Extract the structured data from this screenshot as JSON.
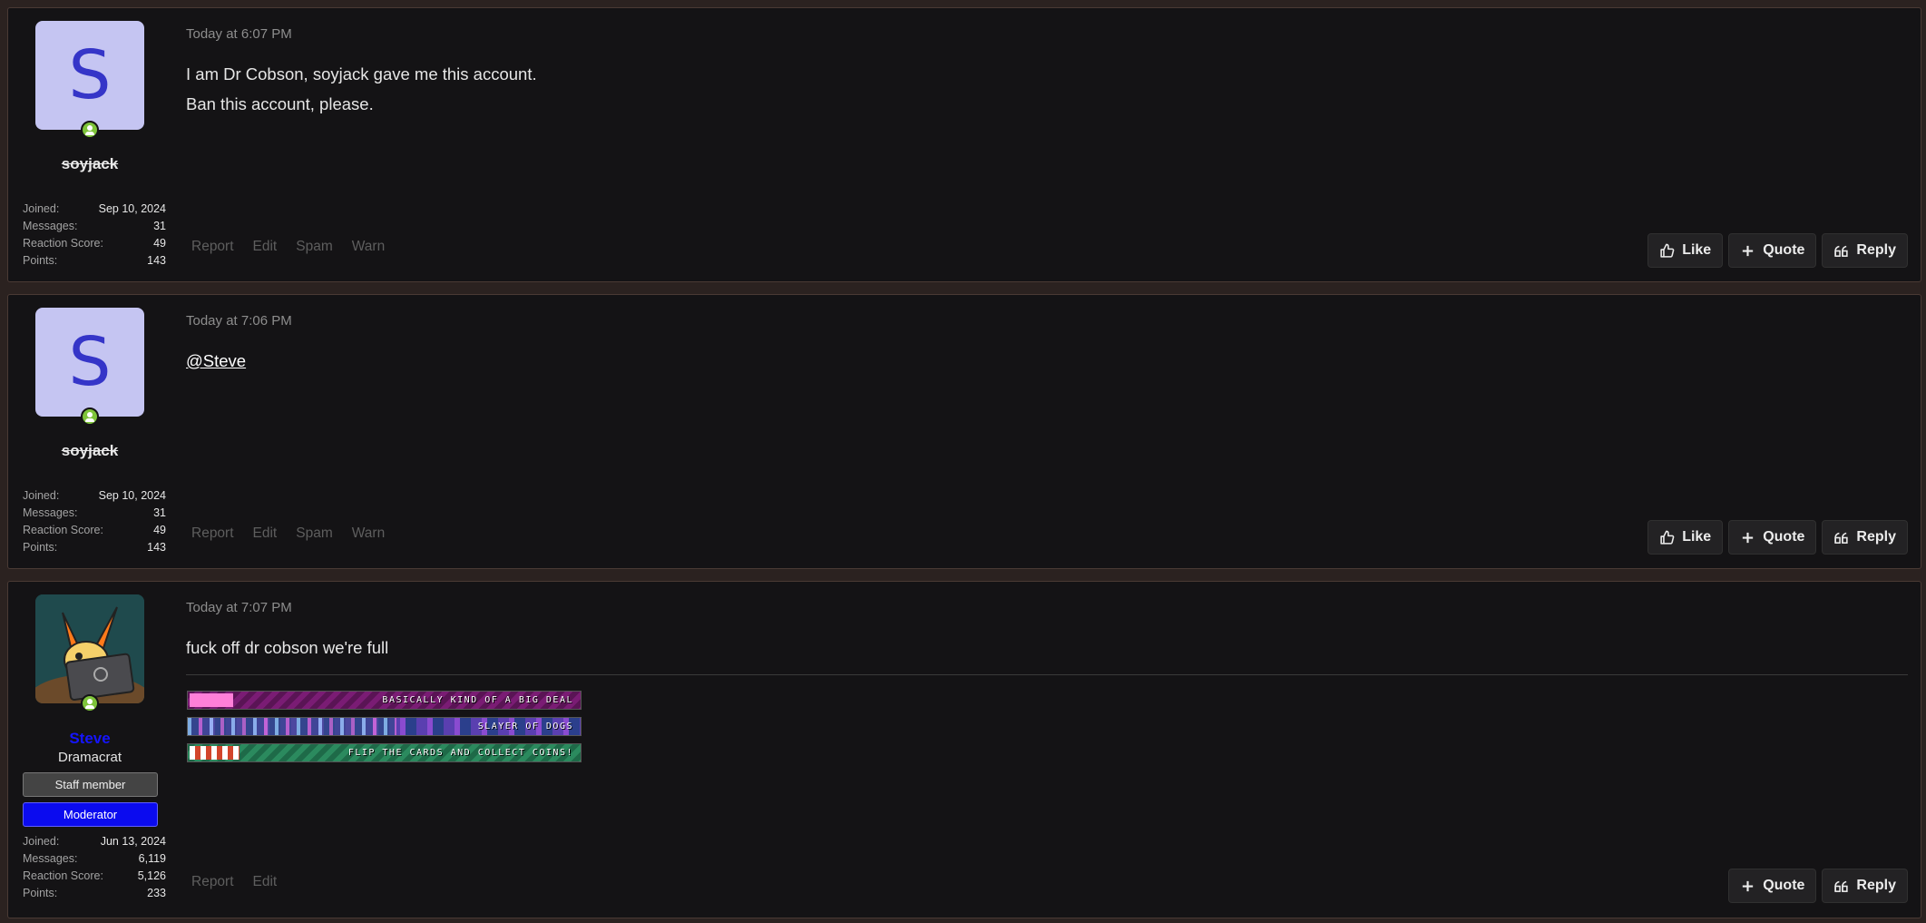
{
  "posts": [
    {
      "author": "soyjack",
      "avatar_letter": "S",
      "timestamp": "Today at 6:07 PM",
      "lines": [
        "I am Dr Cobson, soyjack gave me this account.",
        "Ban this account, please."
      ],
      "stats": [
        {
          "label": "Joined:",
          "value": "Sep 10, 2024"
        },
        {
          "label": "Messages:",
          "value": "31"
        },
        {
          "label": "Reaction Score:",
          "value": "49"
        },
        {
          "label": "Points:",
          "value": "143"
        }
      ],
      "mod_actions": [
        "Report",
        "Edit",
        "Spam",
        "Warn"
      ],
      "buttons": {
        "like": "Like",
        "quote": "Quote",
        "reply": "Reply"
      }
    },
    {
      "author": "soyjack",
      "avatar_letter": "S",
      "timestamp": "Today at 7:06 PM",
      "mention": "@Steve",
      "stats": [
        {
          "label": "Joined:",
          "value": "Sep 10, 2024"
        },
        {
          "label": "Messages:",
          "value": "31"
        },
        {
          "label": "Reaction Score:",
          "value": "49"
        },
        {
          "label": "Points:",
          "value": "143"
        }
      ],
      "mod_actions": [
        "Report",
        "Edit",
        "Spam",
        "Warn"
      ],
      "buttons": {
        "like": "Like",
        "quote": "Quote",
        "reply": "Reply"
      }
    },
    {
      "author": "Steve",
      "user_title": "Dramacrat",
      "banners": [
        "Staff member",
        "Moderator"
      ],
      "timestamp": "Today at 7:07 PM",
      "lines": [
        "fuck off dr cobson we're full"
      ],
      "signature": [
        "BASICALLY KIND OF A BIG DEAL",
        "SLAYER OF DOGS",
        "FLIP THE CARDS AND COLLECT COINS!"
      ],
      "stats": [
        {
          "label": "Joined:",
          "value": "Jun 13, 2024"
        },
        {
          "label": "Messages:",
          "value": "6,119"
        },
        {
          "label": "Reaction Score:",
          "value": "5,126"
        },
        {
          "label": "Points:",
          "value": "233"
        }
      ],
      "mod_actions": [
        "Report",
        "Edit"
      ],
      "buttons": {
        "quote": "Quote",
        "reply": "Reply"
      }
    }
  ],
  "colors": {
    "background": "#2b2220",
    "post_background": "#141315",
    "avatar_bg": "#c5c5f2",
    "avatar_letter": "#3535c8",
    "online_indicator": "#7ec43a",
    "moderator_banner": "#0b0bef",
    "steve_username": "#1515ff"
  }
}
